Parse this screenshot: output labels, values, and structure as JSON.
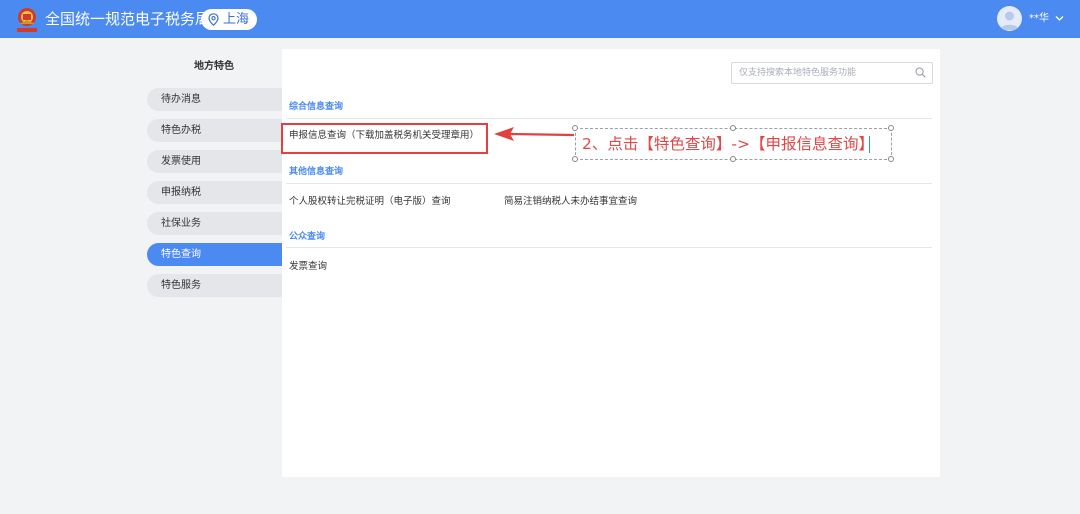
{
  "header": {
    "title": "全国统一规范电子税务局",
    "region": "上海",
    "user_name": "**华",
    "logo_icon": "tax-bureau-emblem",
    "location_icon": "location-pin-icon",
    "chevron_icon": "chevron-down-icon"
  },
  "sidebar": {
    "title": "地方特色",
    "items": [
      {
        "label": "待办消息"
      },
      {
        "label": "特色办税"
      },
      {
        "label": "发票使用"
      },
      {
        "label": "申报纳税"
      },
      {
        "label": "社保业务"
      },
      {
        "label": "特色查询"
      },
      {
        "label": "特色服务"
      }
    ],
    "active_index": 5
  },
  "search": {
    "placeholder": "仅支持搜索本地特色服务功能",
    "icon": "search-icon"
  },
  "sections": [
    {
      "title": "综合信息查询",
      "links": [
        "申报信息查询（下载加盖税务机关受理章用）"
      ]
    },
    {
      "title": "其他信息查询",
      "links": [
        "个人股权转让完税证明（电子版）查询",
        "简易注销纳税人未办结事宜查询"
      ]
    },
    {
      "title": "公众查询",
      "links": [
        "发票查询"
      ]
    }
  ],
  "annotation": {
    "text": "2、点击【特色查询】->【申报信息查询】"
  },
  "colors": {
    "brand_blue": "#4b8af0",
    "highlight_red": "#e34141",
    "annotation_red": "#e04848"
  }
}
